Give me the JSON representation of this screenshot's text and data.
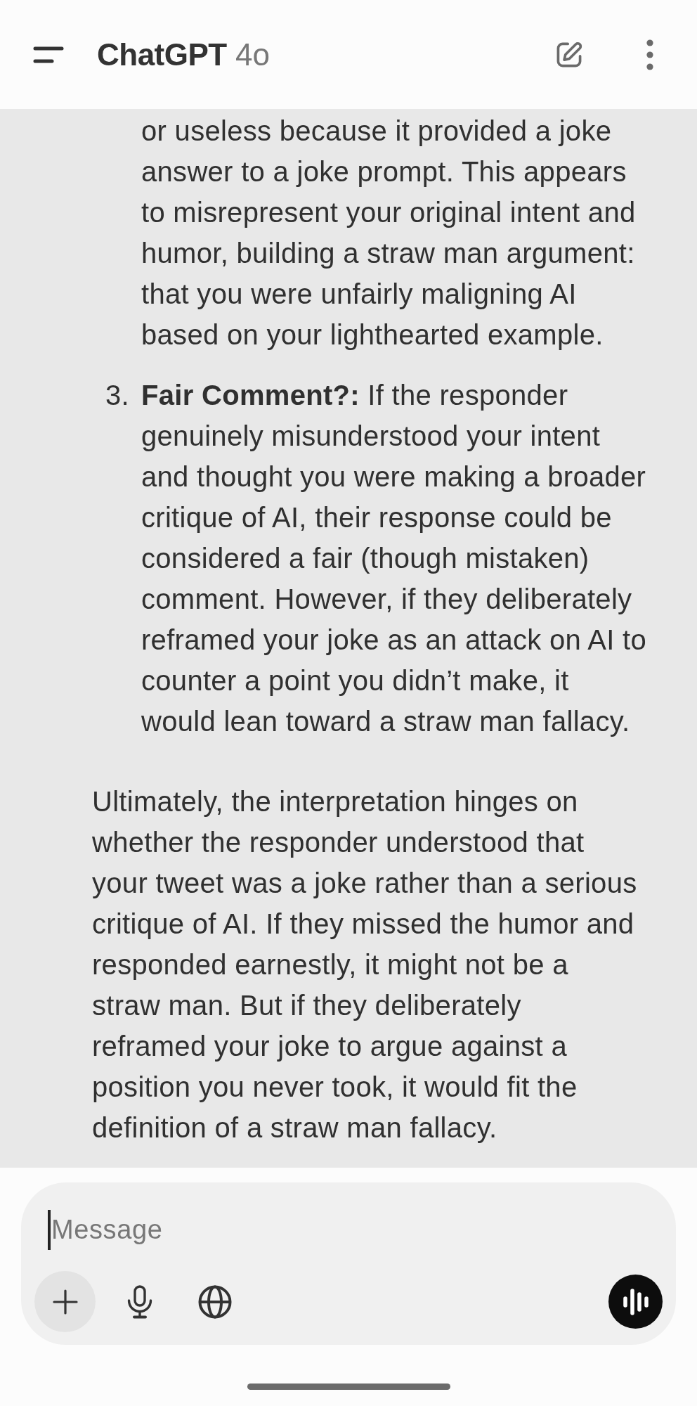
{
  "header": {
    "title": "ChatGPT",
    "model": "4o"
  },
  "conversation": {
    "blocks": [
      {
        "kind": "list_item",
        "text": "or useless because it provided a joke answer to a joke prompt. This appears to misrepresent your original intent and humor, building a straw man argument: that you were unfairly maligning AI based on your lighthearted example."
      },
      {
        "kind": "list_item",
        "number": "3.",
        "text": "**Fair Comment?:** If the responder genuinely misunderstood your intent and thought you were making a broader critique of AI, their response could be considered a fair (though mistaken) comment. However, if they deliberately reframed your joke as an attack on AI to counter a point you didn’t make, it would lean toward a straw man fallacy."
      },
      {
        "kind": "paragraph",
        "text": "Ultimately, the interpretation hinges on whether the responder understood that your tweet was a joke rather than a serious critique of AI. If they missed the humor and responded earnestly, it might not be a straw man. But if they deliberately reframed your joke to argue against a position you never took, it would fit the definition of a straw man fallacy."
      }
    ]
  },
  "composer": {
    "placeholder": "Message",
    "focused": true
  }
}
